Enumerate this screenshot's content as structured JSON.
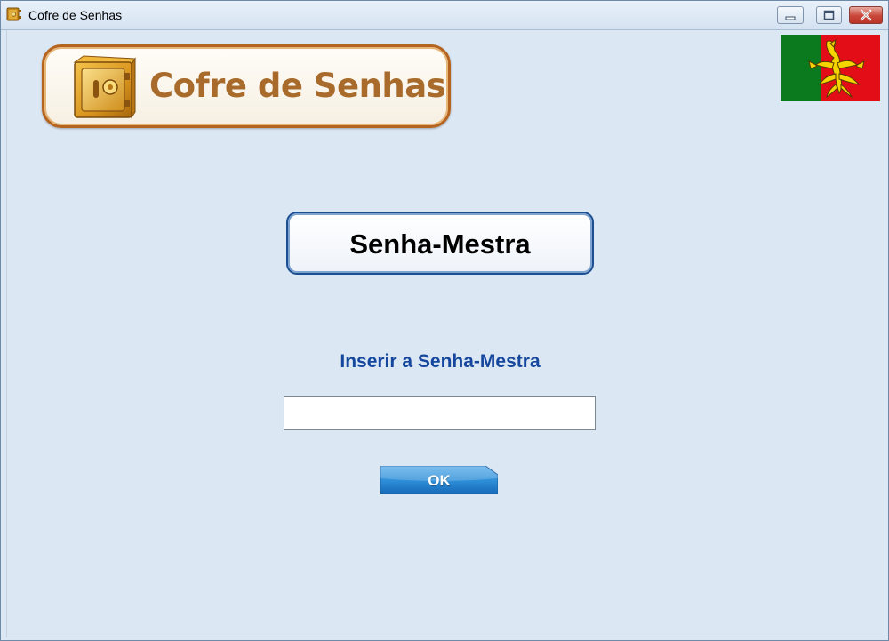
{
  "window": {
    "title": "Cofre de Senhas",
    "icon": "safe-icon",
    "controls": [
      "minimize-icon",
      "maximize-icon",
      "close-icon"
    ]
  },
  "logo": {
    "text": "Cofre de Senhas",
    "icon": "safe-icon"
  },
  "flag": {
    "icon": "scorpion-flag-icon",
    "colors": [
      "#0b7a1f",
      "#e30d17",
      "#f5d400"
    ]
  },
  "section": {
    "title": "Senha-Mestra"
  },
  "form": {
    "prompt": "Inserir a Senha-Mestra",
    "password_value": "",
    "ok_label": "OK"
  },
  "colors": {
    "background": "#dbe7f3",
    "prompt_text": "#14479d",
    "logo_text": "#a86b2b",
    "logo_border": "#b5641f",
    "section_border": "#1c4f92",
    "ok_button": "#1d7fd0"
  }
}
